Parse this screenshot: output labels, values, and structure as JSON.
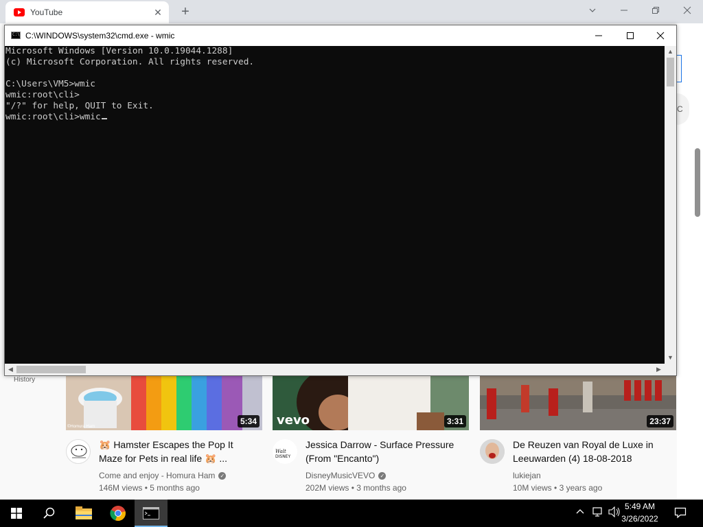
{
  "browser": {
    "tab_title": "YouTube",
    "tab_close_glyph": "✕",
    "new_tab_glyph": "+"
  },
  "youtube": {
    "sidebar_history": "History",
    "right_pill_text": "C",
    "videos": [
      {
        "title": "🐹 Hamster Escapes the Pop It Maze for Pets in real life 🐹 ...",
        "channel": "Come and enjoy - Homura Ham",
        "verified": true,
        "views": "146M views",
        "age": "5 months ago",
        "duration": "5:34",
        "thumb_watermark": "©Homura Ham"
      },
      {
        "title": "Jessica Darrow - Surface Pressure (From \"Encanto\")",
        "channel": "DisneyMusicVEVO",
        "verified": true,
        "views": "202M views",
        "age": "3 months ago",
        "duration": "3:31",
        "thumb_watermark": "vevo"
      },
      {
        "title": "De Reuzen van Royal de Luxe in Leeuwarden (4) 18-08-2018",
        "channel": "lukiejan",
        "verified": false,
        "views": "10M views",
        "age": "3 years ago",
        "duration": "23:37",
        "thumb_watermark": ""
      }
    ]
  },
  "cmd": {
    "title": "C:\\WINDOWS\\system32\\cmd.exe - wmic",
    "lines": [
      "Microsoft Windows [Version 10.0.19044.1288]",
      "(c) Microsoft Corporation. All rights reserved.",
      "",
      "C:\\Users\\VM5>wmic",
      "wmic:root\\cli>",
      "\"/?\" for help, QUIT to Exit.",
      "wmic:root\\cli>wmic"
    ]
  },
  "taskbar": {
    "time": "5:49 AM",
    "date": "3/26/2022"
  },
  "icons": {
    "minimize": "minimize-icon",
    "maximize": "maximize-icon",
    "close": "close-icon",
    "start": "windows-start-icon",
    "search": "search-icon"
  }
}
